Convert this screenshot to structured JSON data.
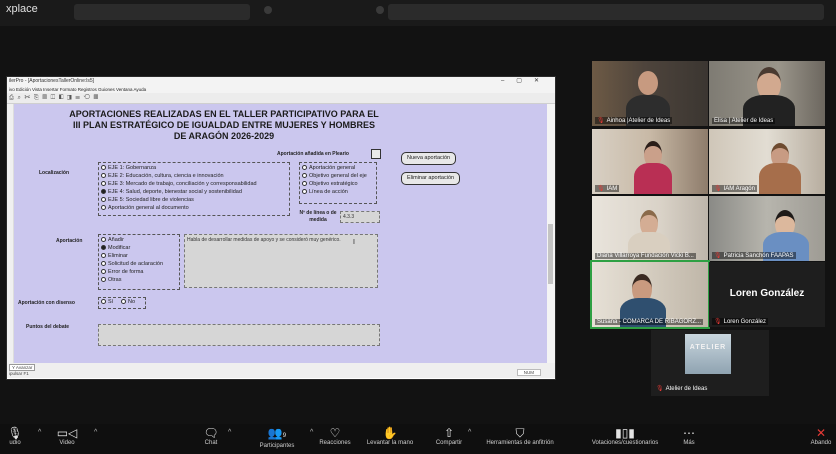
{
  "zoom": {
    "top_title": "xplace",
    "controls": {
      "audio": "udio",
      "video": "Video",
      "chat": "Chat",
      "participants": "Participantes",
      "participants_count": "9",
      "reactions": "Reacciones",
      "raise_hand": "Levantar la mano",
      "share": "Compartir",
      "apps": "Herramientas de anfitrión",
      "polls": "Votaciones/cuestionarios",
      "more": "Más",
      "leave": "Abando"
    },
    "big_name": "Loren González",
    "tiles": [
      {
        "name": "Ainhoa |Atelier de Ideas",
        "muted": true
      },
      {
        "name": "Elisa | Atelier de Ideas",
        "muted": false
      },
      {
        "name": "IAM",
        "muted": true
      },
      {
        "name": "IAM Aragón",
        "muted": true
      },
      {
        "name": "Diana Villarroya Fundación Vicki B...",
        "muted": false
      },
      {
        "name": "Patricia Sanchón FAAPAS",
        "muted": true
      },
      {
        "name": "Susana - COMARCA DE RIBAGORZ...",
        "muted": false
      },
      {
        "name": "Loren González",
        "muted": true
      },
      {
        "name": "Atelier de Ideas",
        "muted": true
      }
    ],
    "atelier_logo_text": "ATELIER"
  },
  "app": {
    "window_title": "ilerPro - [AportacionesTallerOnline:ls5]",
    "menu": "ivo  Edición  Vista  Insertar  Formato  Registros  Guiones  Ventana  Ayuda",
    "toolbar_glyphs": "⎙ ⌕ ✂ ⎘ ▤ ◫ ◧ ◨ ☰ ⟲ ▦",
    "form": {
      "title_line1": "APORTACIONES REALIZADAS EN EL TALLER PARTICIPATIVO PARA EL",
      "title_line2": "III PLAN ESTRATÉGICO DE IGUALDAD ENTRE MUJERES Y HOMBRES",
      "title_line3": "DE ARAGÓN 2026-2029",
      "added_label": "Aportación añadida en Pleario",
      "localizacion_label": "Localización",
      "ejes": [
        {
          "label": "EJE 1: Gobernanza",
          "selected": false
        },
        {
          "label": "EJE 2: Educación, cultura, ciencia e innovación",
          "selected": false
        },
        {
          "label": "EJE 3: Mercado de trabajo, conciliación y corresponsabilidad",
          "selected": false
        },
        {
          "label": "EJE 4: Salud, deporte, bienestar social y sostenibilidad",
          "selected": true
        },
        {
          "label": "EJE 5: Sociedad libre de violencias",
          "selected": false
        },
        {
          "label": "Aportación general al documento",
          "selected": false
        }
      ],
      "tipo": [
        {
          "label": "Aportación general",
          "selected": false
        },
        {
          "label": "Objetivo general del eje",
          "selected": false
        },
        {
          "label": "Objetivo estratégico",
          "selected": false
        },
        {
          "label": "Línea de acción",
          "selected": false
        }
      ],
      "linea_label": "Nº de línea o de medida",
      "linea_value": "4.3.3",
      "nueva_btn": "Nueva aportación",
      "eliminar_btn": "Eliminar aportación",
      "aportacion_label": "Aportación",
      "acciones": [
        {
          "label": "Añadir",
          "selected": false
        },
        {
          "label": "Modificar",
          "selected": true
        },
        {
          "label": "Eliminar",
          "selected": false
        },
        {
          "label": "Solicitud de aclaración",
          "selected": false
        },
        {
          "label": "Error de forma",
          "selected": false
        },
        {
          "label": "Otras",
          "selected": false
        }
      ],
      "aportacion_text": "Habla de desarrollar medidas de apoyo y se consideró muy genérico.",
      "disenso_label": "Aportación con disenso",
      "si": "Sí",
      "no": "No",
      "puntos_label": "Puntos del debate",
      "status_left": "Y Avanzar",
      "status_left2": "ipulsar F1",
      "status_right": "NUM"
    }
  }
}
